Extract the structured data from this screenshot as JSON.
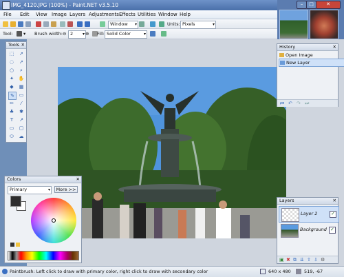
{
  "title_bar": {
    "title": "IMG_4120.JPG (100%) - Paint.NET v3.5.10"
  },
  "menu": [
    "File",
    "Edit",
    "View",
    "Image",
    "Layers",
    "Adjustments",
    "Effects",
    "Utilities",
    "Window",
    "Help"
  ],
  "toolbar1": {
    "zoom_value": "Window",
    "units_label": "Units:",
    "units_value": "Pixels"
  },
  "toolbar2": {
    "tool_label": "Tool:",
    "brush_width_label": "Brush width:",
    "brush_width_value": "2",
    "fill_label": "Fill:",
    "fill_value": "Solid Color"
  },
  "tools_panel": {
    "title": "Tools"
  },
  "history_panel": {
    "title": "History",
    "items": [
      "Open Image",
      "New Layer"
    ]
  },
  "layers_panel": {
    "title": "Layers",
    "layers": [
      "Layer 2",
      "Background"
    ]
  },
  "colors_panel": {
    "title": "Colors",
    "mode_value": "Primary",
    "more_button": "More >>"
  },
  "status": {
    "hint": "Paintbrush: Left click to draw with primary color, right click to draw with secondary color",
    "size": "640 x 480",
    "coords": "519, -67"
  },
  "colors": {
    "accent": "#3a6fc2",
    "title_bar": "#4a70aa"
  }
}
